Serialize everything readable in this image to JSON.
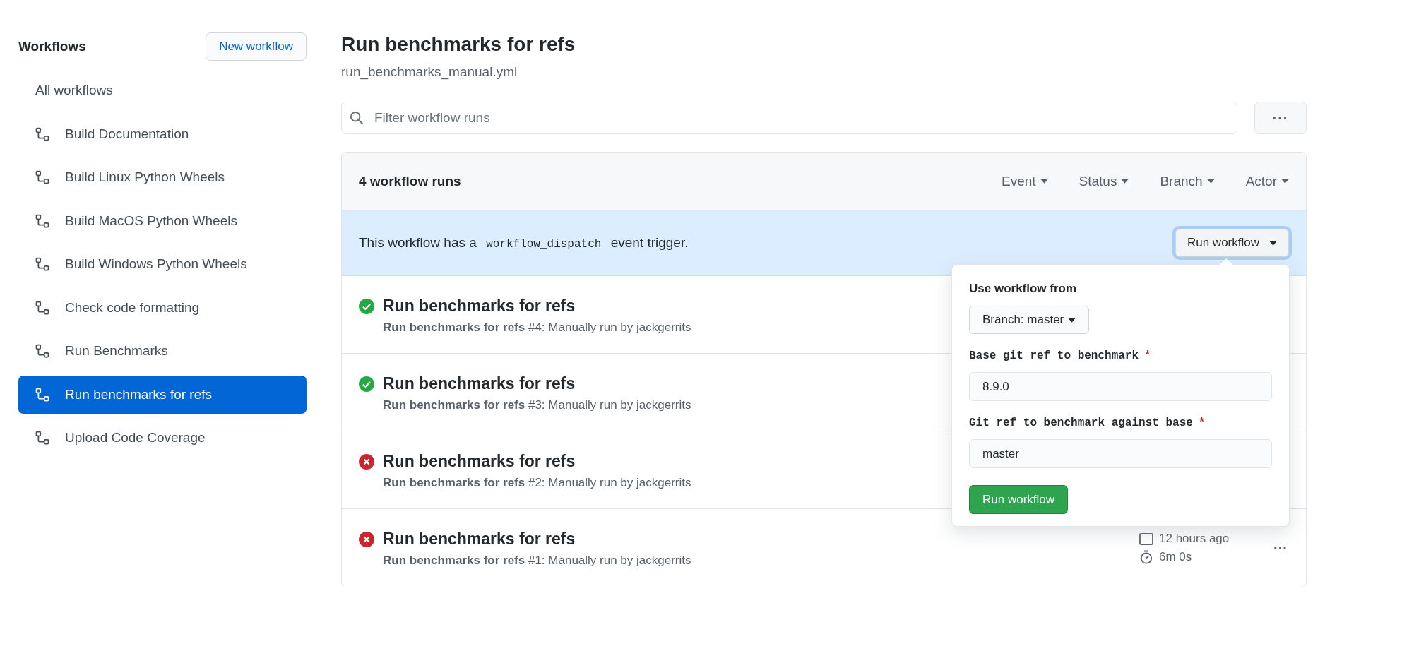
{
  "sidebar": {
    "title": "Workflows",
    "new_button": "New workflow",
    "items": [
      {
        "label": "All workflows",
        "kind": "all",
        "selected": false
      },
      {
        "label": "Build Documentation",
        "kind": "workflow",
        "selected": false
      },
      {
        "label": "Build Linux Python Wheels",
        "kind": "workflow",
        "selected": false
      },
      {
        "label": "Build MacOS Python Wheels",
        "kind": "workflow",
        "selected": false
      },
      {
        "label": "Build Windows Python Wheels",
        "kind": "workflow",
        "selected": false
      },
      {
        "label": "Check code formatting",
        "kind": "workflow",
        "selected": false
      },
      {
        "label": "Run Benchmarks",
        "kind": "workflow",
        "selected": false
      },
      {
        "label": "Run benchmarks for refs",
        "kind": "workflow",
        "selected": true
      },
      {
        "label": "Upload Code Coverage",
        "kind": "workflow",
        "selected": false
      }
    ]
  },
  "main": {
    "title": "Run benchmarks for refs",
    "filename": "run_benchmarks_manual.yml",
    "filter": {
      "placeholder": "Filter workflow runs"
    },
    "more_button": "···",
    "header": {
      "count": "4 workflow runs",
      "filters": [
        "Event",
        "Status",
        "Branch",
        "Actor"
      ]
    },
    "banner": {
      "text_before": "This workflow has a",
      "code": "workflow_dispatch",
      "text_after": "event trigger.",
      "button": "Run workflow"
    },
    "runs": [
      {
        "kind": "success",
        "title": "Run benchmarks for refs",
        "subtitle": "**Run benchmarks for refs** #4: Manually run by jackgerrits"
      },
      {
        "kind": "success",
        "title": "Run benchmarks for refs",
        "subtitle": "**Run benchmarks for refs** #3: Manually run by jackgerrits"
      },
      {
        "kind": "failure",
        "title": "Run benchmarks for refs",
        "subtitle": "**Run benchmarks for refs** #2: Manually run by jackgerrits"
      },
      {
        "kind": "failure",
        "title": "Run benchmarks for refs",
        "subtitle": "**Run benchmarks for refs** #1: Manually run by jackgerrits",
        "time": "12 hours ago",
        "duration": "6m 0s",
        "menu": "···"
      }
    ],
    "popover": {
      "heading": "Use workflow from",
      "branch_button": "Branch: master",
      "fields": [
        {
          "label": "Base git ref to benchmark",
          "required": true,
          "required_mark": "*",
          "value": "8.9.0"
        },
        {
          "label": "Git ref to benchmark against base",
          "required": true,
          "required_mark": "*",
          "value": "master"
        }
      ],
      "submit": "Run workflow"
    }
  }
}
